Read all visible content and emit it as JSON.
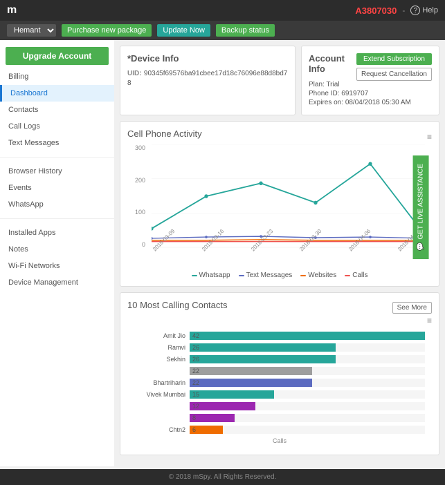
{
  "topbar": {
    "logo": "m",
    "account_id": "A3807030",
    "divider": "-",
    "help_label": "Help"
  },
  "subbar": {
    "select_value": "Hemant",
    "btn_purchase": "Purchase new package",
    "btn_update": "Update Now",
    "btn_backup": "Backup status"
  },
  "sidebar": {
    "upgrade_label": "Upgrade Account",
    "items": [
      {
        "label": "Billing",
        "active": false
      },
      {
        "label": "Dashboard",
        "active": true
      },
      {
        "label": "Contacts",
        "active": false
      },
      {
        "label": "Call Logs",
        "active": false
      },
      {
        "label": "Text Messages",
        "active": false
      },
      {
        "label": "Browser History",
        "active": false
      },
      {
        "label": "Events",
        "active": false
      },
      {
        "label": "WhatsApp",
        "active": false
      },
      {
        "label": "Installed Apps",
        "active": false
      },
      {
        "label": "Notes",
        "active": false
      },
      {
        "label": "Wi-Fi Networks",
        "active": false
      },
      {
        "label": "Device Management",
        "active": false
      }
    ]
  },
  "device_info": {
    "title": "*Device Info",
    "uid_label": "UID:",
    "uid_value": "90345f69576ba91cbee17d18c76096e88d8bd78"
  },
  "account_info": {
    "title": "Account Info",
    "btn_extend": "Extend Subscription",
    "btn_cancel": "Request Cancellation",
    "plan_label": "Plan:",
    "plan_value": "Trial",
    "phone_label": "Phone ID:",
    "phone_value": "6919707",
    "expires_label": "Expires on:",
    "expires_value": "08/04/2018 05:30 AM"
  },
  "cell_phone_activity": {
    "title": "Cell Phone Activity",
    "y_labels": [
      "300",
      "200",
      "100",
      "0"
    ],
    "x_labels": [
      "2018-03-09",
      "2018-03-16",
      "2018-03-23",
      "2018-03-30",
      "2018-04-06",
      "2018-04-13"
    ],
    "legend": [
      {
        "label": "Whatsapp",
        "color": "#26a69a"
      },
      {
        "label": "Text Messages",
        "color": "#5c6bc0"
      },
      {
        "label": "Websites",
        "color": "#ef6c00"
      },
      {
        "label": "Calls",
        "color": "#ef5350"
      }
    ]
  },
  "most_calling": {
    "title": "10 Most Calling Contacts",
    "see_more": "See More",
    "x_label": "Calls",
    "bars": [
      {
        "label": "Amit Jio",
        "count": 42,
        "color": "#26a69a",
        "width": 100
      },
      {
        "label": "Ramvi",
        "count": 26,
        "color": "#26a69a",
        "width": 62
      },
      {
        "label": "Sekhin",
        "count": 26,
        "color": "#26a69a",
        "width": 62
      },
      {
        "label": "",
        "count": 22,
        "color": "#9e9e9e",
        "width": 52
      },
      {
        "label": "Bhartriharin",
        "count": 22,
        "color": "#5c6bc0",
        "width": 52
      },
      {
        "label": "Vivek Mumbai",
        "count": 15,
        "color": "#26a69a",
        "width": 36
      },
      {
        "label": "",
        "count": 12,
        "color": "#9c27b0",
        "width": 28
      },
      {
        "label": "",
        "count": 8,
        "color": "#9c27b0",
        "width": 19
      },
      {
        "label": "Chtn2",
        "count": 6,
        "color": "#ef6c00",
        "width": 14
      }
    ]
  },
  "live_assist": {
    "label": "GET LIVE ASSISTANCE"
  },
  "footer": {
    "text": "© 2018 mSpy. All Rights Reserved."
  }
}
